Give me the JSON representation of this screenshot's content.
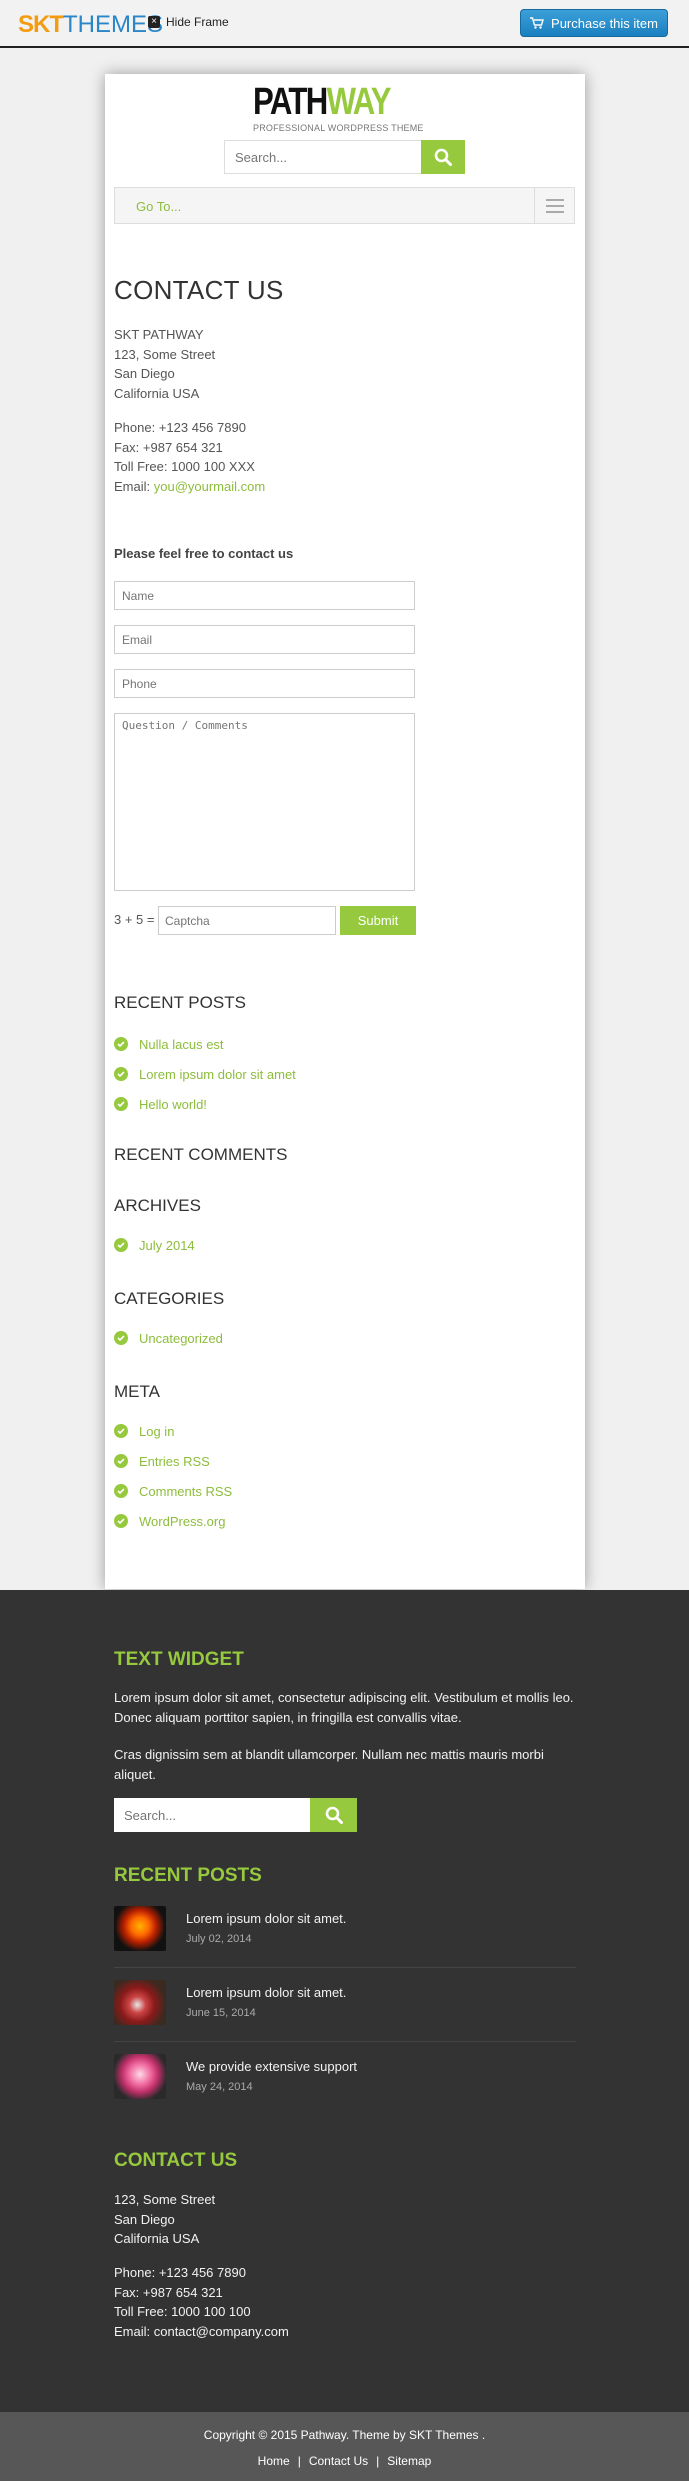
{
  "frame": {
    "brand_part1": "SKT",
    "brand_part2": "THEMES",
    "hide_frame": "Hide Frame",
    "purchase": "Purchase this item"
  },
  "site": {
    "logo_part1": "PATH",
    "logo_part2": "WAY",
    "tagline": "PROFESSIONAL WORDPRESS THEME",
    "search_placeholder": "Search...",
    "goto": "Go To..."
  },
  "contact": {
    "title": "CONTACT US",
    "address_lines": [
      "SKT PATHWAY",
      "123, Some Street",
      "San Diego",
      "California USA"
    ],
    "phone": "Phone: +123 456 7890",
    "fax": "Fax: +987 654 321",
    "toll_free": "Toll Free: 1000 100 XXX",
    "email_label": "Email: ",
    "email": "you@yourmail.com",
    "form_heading": "Please feel free to contact us",
    "name_placeholder": "Name",
    "email_placeholder": "Email",
    "phone_placeholder": "Phone",
    "comments_placeholder": "Question / Comments",
    "captcha_question": "3 + 5 =",
    "captcha_placeholder": "Captcha",
    "submit": "Submit"
  },
  "sidebar": {
    "recent_posts_heading": "RECENT POSTS",
    "recent_posts": [
      "Nulla lacus est",
      "Lorem ipsum dolor sit amet",
      "Hello world!"
    ],
    "recent_comments_heading": "RECENT COMMENTS",
    "archives_heading": "ARCHIVES",
    "archives": [
      "July 2014"
    ],
    "categories_heading": "CATEGORIES",
    "categories": [
      "Uncategorized"
    ],
    "meta_heading": "META",
    "meta": [
      "Log in",
      "Entries RSS",
      "Comments RSS",
      "WordPress.org"
    ]
  },
  "footer": {
    "text_widget_heading": "TEXT WIDGET",
    "text_p1": "Lorem ipsum dolor sit amet, consectetur adipiscing elit. Vestibulum et mollis leo. Donec aliquam porttitor sapien, in fringilla est convallis vitae.",
    "text_p2": "Cras dignissim sem at blandit ullamcorper. Nullam nec mattis mauris morbi aliquet.",
    "search_placeholder": "Search...",
    "recent_posts_heading": "RECENT POSTS",
    "posts": [
      {
        "title": "Lorem ipsum dolor sit amet.",
        "date": "July 02, 2014"
      },
      {
        "title": "Lorem ipsum dolor sit amet.",
        "date": "June 15, 2014"
      },
      {
        "title": "We provide extensive support",
        "date": "May 24, 2014"
      }
    ],
    "contact_heading": "CONTACT US",
    "address_lines": [
      "123, Some Street",
      "San Diego",
      "California USA"
    ],
    "phone": "Phone: +123 456 7890",
    "fax": "Fax: +987 654 321",
    "toll_free": "Toll Free: 1000 100 100",
    "email": "Email: contact@company.com"
  },
  "bottom": {
    "copyright": "Copyright © 2015 Pathway. Theme by  SKT Themes .",
    "links": [
      "Home",
      "Contact Us",
      "Sitemap"
    ]
  },
  "colors": {
    "accent": "#96c93d",
    "brand_orange": "#f39c12",
    "brand_blue": "#2a86c8",
    "footer_bg": "#333333",
    "bottom_bar_bg": "#575757"
  }
}
